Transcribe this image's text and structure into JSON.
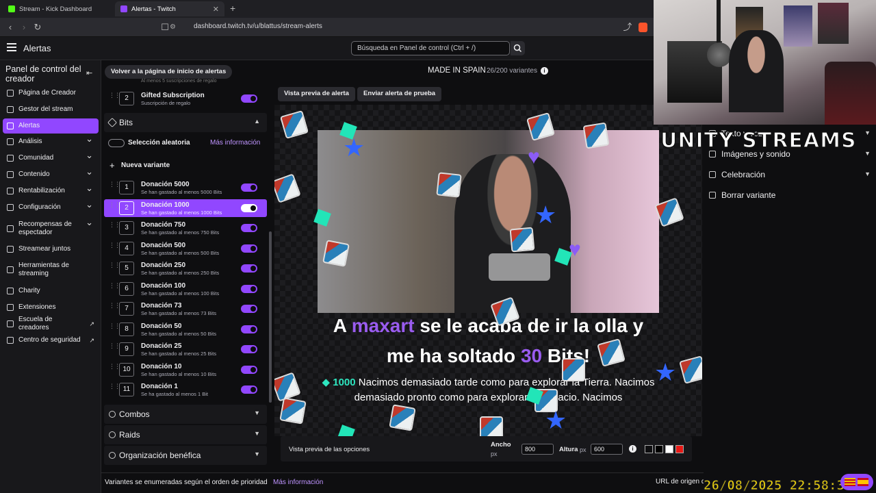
{
  "browser": {
    "tabs": [
      {
        "title": "Stream - Kick Dashboard",
        "favicon_color": "#53fc18"
      },
      {
        "title": "Alertas - Twitch",
        "favicon_color": "#9147ff"
      }
    ],
    "url": "dashboard.twitch.tv/u/blattus/stream-alerts"
  },
  "topnav": {
    "title": "Alertas",
    "search_placeholder": "Búsqueda en Panel de control (Ctrl + /)"
  },
  "sidebar": {
    "title": "Panel de control del creador",
    "items": [
      {
        "label": "Página de Creador",
        "has_chevron": false
      },
      {
        "label": "Gestor del stream",
        "has_chevron": false
      },
      {
        "label": "Alertas",
        "has_chevron": false,
        "active": true
      },
      {
        "label": "Análisis",
        "has_chevron": true
      },
      {
        "label": "Comunidad",
        "has_chevron": true
      },
      {
        "label": "Contenido",
        "has_chevron": true
      },
      {
        "label": "Rentabilización",
        "has_chevron": true
      },
      {
        "label": "Configuración",
        "has_chevron": true
      },
      {
        "label": "Recompensas de espectador",
        "has_chevron": true
      },
      {
        "label": "Streamear juntos",
        "has_chevron": false
      },
      {
        "label": "Herramientas de streaming",
        "has_chevron": false
      },
      {
        "label": "Charity",
        "has_chevron": false
      },
      {
        "label": "Extensiones",
        "has_chevron": false
      },
      {
        "label": "Escuela de creadores",
        "has_chevron": false,
        "external": true
      },
      {
        "label": "Centro de seguridad",
        "has_chevron": false,
        "external": true
      }
    ]
  },
  "variants_panel": {
    "back_label": "Volver a la página de inicio de alertas",
    "partial_row_desc": "Al menos 5 suscripciones de regalo",
    "gifted": {
      "num": "2",
      "name": "Gifted Subscription",
      "desc": "Suscripción de regalo"
    },
    "bits_section": "Bits",
    "random_label": "Selección aleatoria",
    "more_info": "Más información",
    "new_variant": "Nueva variante",
    "bits_variants": [
      {
        "num": "1",
        "name": "Donación 5000",
        "desc": "Se han gastado al menos 5000 Bits"
      },
      {
        "num": "2",
        "name": "Donación 1000",
        "desc": "Se han gastado al menos 1000 Bits",
        "selected": true
      },
      {
        "num": "3",
        "name": "Donación 750",
        "desc": "Se han gastado al menos 750 Bits"
      },
      {
        "num": "4",
        "name": "Donación 500",
        "desc": "Se han gastado al menos 500 Bits"
      },
      {
        "num": "5",
        "name": "Donación 250",
        "desc": "Se han gastado al menos 250 Bits"
      },
      {
        "num": "6",
        "name": "Donación 100",
        "desc": "Se han gastado al menos 100 Bits"
      },
      {
        "num": "7",
        "name": "Donación 73",
        "desc": "Se han gastado al menos 73 Bits"
      },
      {
        "num": "8",
        "name": "Donación 50",
        "desc": "Se han gastado al menos 50 Bits"
      },
      {
        "num": "9",
        "name": "Donación 25",
        "desc": "Se han gastado al menos 25 Bits"
      },
      {
        "num": "10",
        "name": "Donación 10",
        "desc": "Se han gastado al menos 10 Bits"
      },
      {
        "num": "11",
        "name": "Donación 1",
        "desc": "Se ha gastado al menos 1 Bit"
      }
    ],
    "sections": [
      {
        "label": "Combos"
      },
      {
        "label": "Raids"
      },
      {
        "label": "Organización benéfica"
      }
    ]
  },
  "preview": {
    "variant_name": "MADE IN SPAIN",
    "variant_count": "26/200 variantes",
    "preview_btn": "Vista previa de alerta",
    "test_btn": "Enviar alerta de prueba",
    "alert": {
      "pre": "A ",
      "user": "maxart",
      "mid": " se le acaba de ir la olla y",
      "line2_pre": "me ha soltado ",
      "amount": "30",
      "line2_post": " Bits!",
      "msg_bits": "1000",
      "msg_text": "Nacimos demasiado tarde como para explorar la Tierra. Nacimos demasiado pronto como para explorar el espacio. Nacimos"
    },
    "options": {
      "title": "Vista previa de las opciones",
      "width_label": "Ancho",
      "width_unit": "px",
      "width_value": "800",
      "height_label": "Altura",
      "height_unit": "px",
      "height_value": "600",
      "swatches": [
        "#0e0e10",
        "#000000",
        "#ffffff",
        "#e91916"
      ]
    }
  },
  "bottom": {
    "note": "Variantes se enumeradas según el orden de prioridad",
    "link": "Más información",
    "origin_label": "URL de origen del navegador"
  },
  "settings_panel": {
    "items": [
      {
        "label": "Texto y voz"
      },
      {
        "label": "Imágenes y sonido"
      },
      {
        "label": "Celebración"
      },
      {
        "label": "Borrar variante"
      }
    ]
  },
  "overlay": {
    "brand": "UNITY STREAMS",
    "timestamp": "26/08/2025 22:58:37"
  }
}
